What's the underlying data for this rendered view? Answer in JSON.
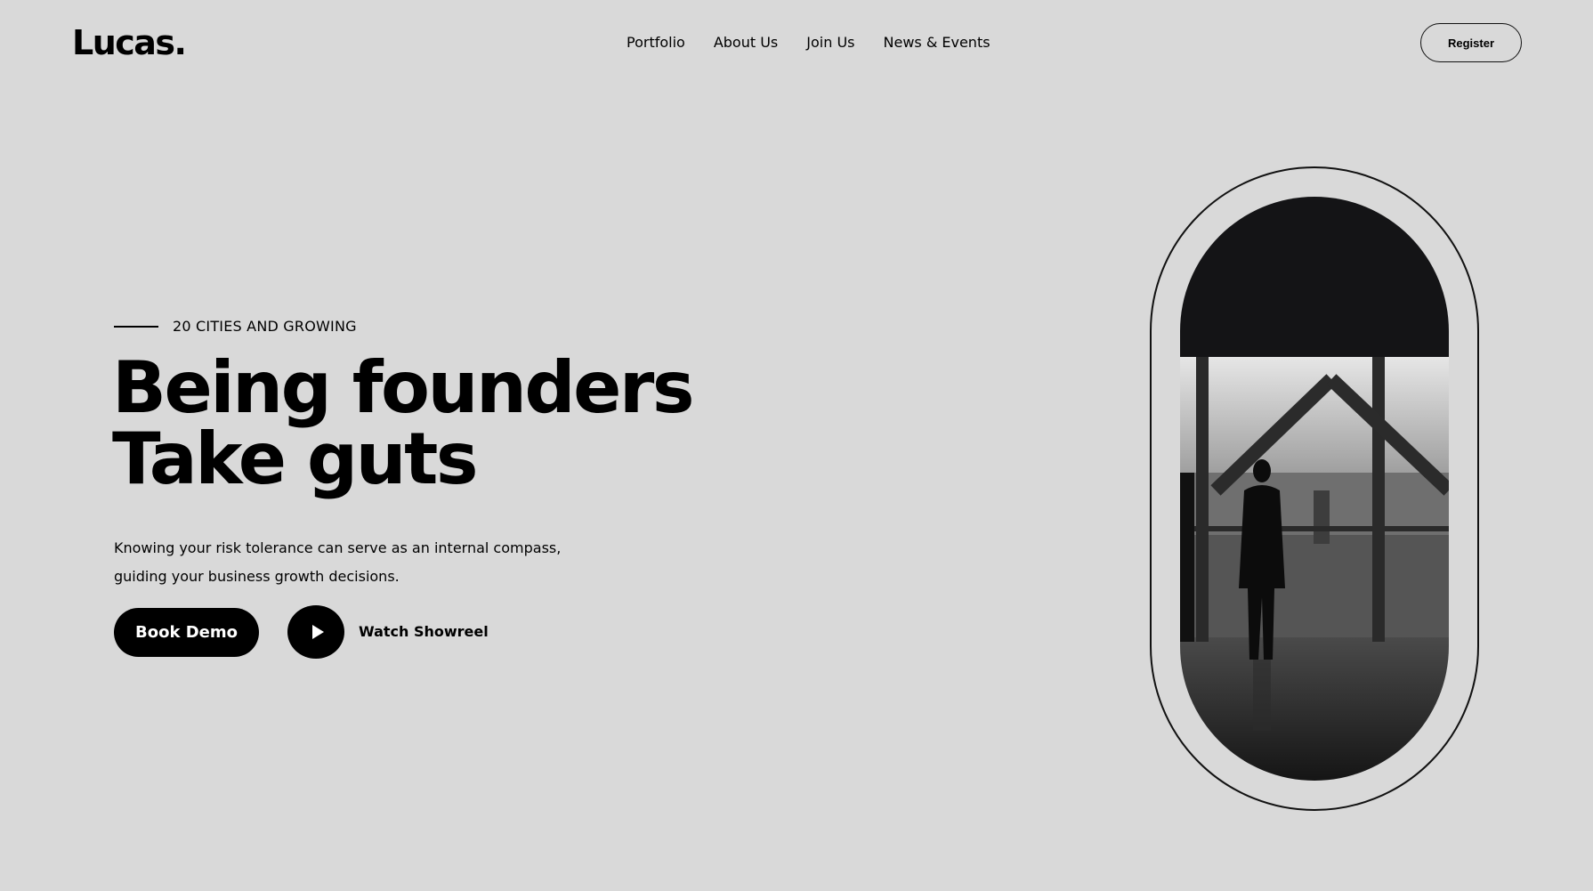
{
  "header": {
    "logo": "Lucas.",
    "nav": [
      "Portfolio",
      "About Us",
      "Join Us",
      "News & Events"
    ],
    "register_label": "Register"
  },
  "hero": {
    "eyebrow": "20 CITIES AND GROWING",
    "headline_lines": [
      "Being founders",
      "Take guts"
    ],
    "description_lines": [
      "Knowing your risk tolerance can serve as an internal compass,",
      "guiding your business growth decisions."
    ],
    "book_demo_label": "Book Demo",
    "watch_showreel_label": "Watch Showreel",
    "image_icon": "city-skyline-photo"
  },
  "colors": {
    "background": "#d9d9d9",
    "primary": "#000000",
    "button_text": "#ffffff"
  }
}
